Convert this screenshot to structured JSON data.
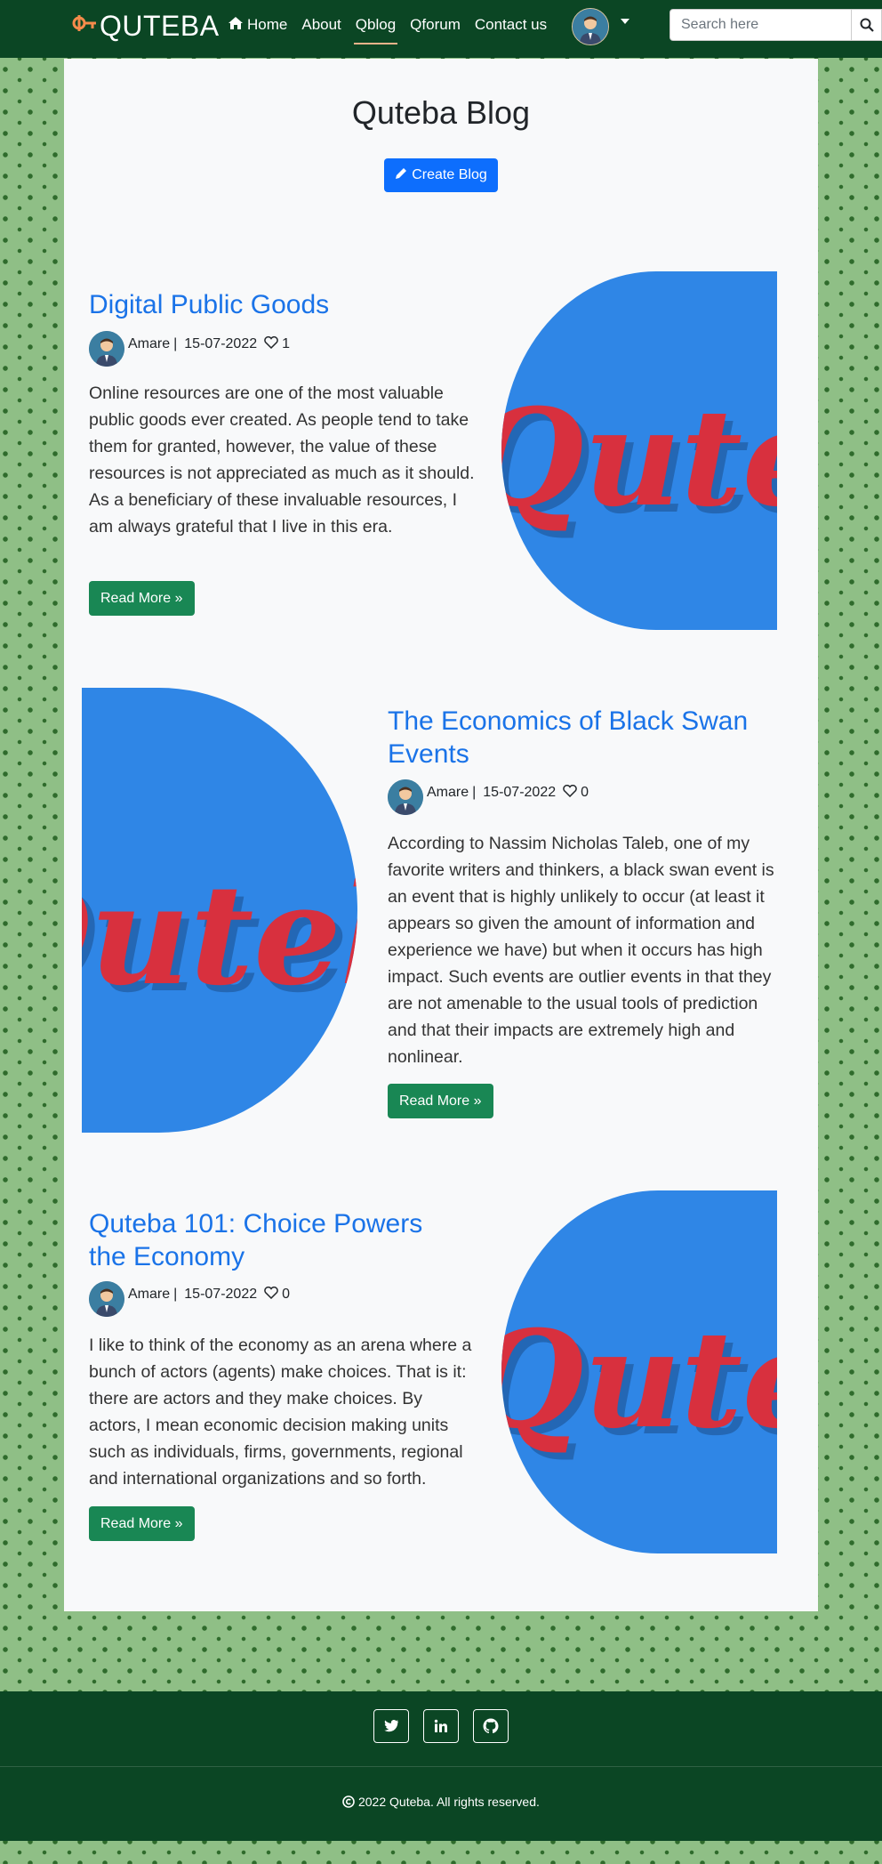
{
  "navbar": {
    "brand": "QUTEBA",
    "brand_icon": "quteba-logo-icon",
    "links": [
      {
        "label": "Home",
        "icon": "home-icon",
        "active": false
      },
      {
        "label": "About",
        "active": false
      },
      {
        "label": "Qblog",
        "active": true
      },
      {
        "label": "Qforum",
        "active": false
      },
      {
        "label": "Contact us",
        "active": false
      }
    ],
    "search_placeholder": "Search here"
  },
  "main": {
    "title": "Quteba Blog",
    "create_button": "Create Blog"
  },
  "posts": [
    {
      "title": "Digital Public Goods",
      "author": "Amare",
      "date": "15-07-2022",
      "likes": "1",
      "excerpt": "Online resources are one of the most valuable public goods ever created. As people tend to take them for granted, however, the value of these resources is not appreciated as much as it should. As a beneficiary of these invaluable resources, I am always grateful that I live in this era.",
      "read_more": "Read More »"
    },
    {
      "title": "The Economics of Black Swan Events",
      "author": "Amare",
      "date": "15-07-2022",
      "likes": "0",
      "excerpt": "According to Nassim Nicholas Taleb, one of my favorite writers and thinkers, a black swan event is an event that is highly unlikely to occur (at least it appears so given the amount of information and experience we have) but when it occurs has high impact. Such events are outlier events in that they are not amenable to the usual tools of prediction and that their impacts are extremely high and nonlinear.",
      "read_more": "Read More »"
    },
    {
      "title": "Quteba 101: Choice Powers the Economy",
      "author": "Amare",
      "date": "15-07-2022",
      "likes": "0",
      "excerpt": "I like to think of the economy as an arena where a bunch of actors (agents) make choices. That is it: there are actors and they make choices. By actors, I mean economic decision making units such as individuals, firms, governments, regional and international organizations and so forth.",
      "read_more": "Read More »"
    }
  ],
  "post_image_text": "Quteba",
  "footer": {
    "social": [
      "twitter-icon",
      "linkedin-icon",
      "github-icon"
    ],
    "copyright": "2022 Quteba. All rights reserved."
  },
  "colors": {
    "nav_bg": "#0b4624",
    "link_blue": "#1a73e8",
    "primary": "#0d6efd",
    "success": "#198754",
    "pattern_bg": "#8fbf86"
  }
}
